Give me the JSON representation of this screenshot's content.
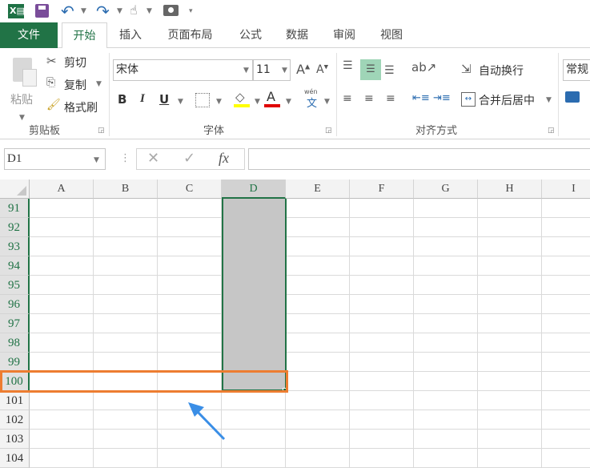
{
  "qat": {
    "icons": [
      "excel-icon",
      "save-icon",
      "undo-icon",
      "redo-icon",
      "touch-mode-icon",
      "camera-icon",
      "customize-icon"
    ]
  },
  "tabs": [
    "文件",
    "开始",
    "插入",
    "页面布局",
    "公式",
    "数据",
    "审阅",
    "视图"
  ],
  "clipboard": {
    "paste": "粘贴",
    "cut": "剪切",
    "copy": "复制",
    "format_painter": "格式刷",
    "label": "剪贴板"
  },
  "font": {
    "name": "宋体",
    "size": "11",
    "bold": "B",
    "italic": "I",
    "underline": "U",
    "font_color": "A",
    "phonetic_top": "wén",
    "phonetic": "文",
    "label": "字体",
    "fill_color": "#ffff00",
    "text_color": "#e00000"
  },
  "alignment": {
    "wrap": "自动换行",
    "merge": "合并后居中",
    "label": "对齐方式"
  },
  "number": {
    "format": "常规"
  },
  "formula_bar": {
    "name_box": "D1",
    "cancel": "✕",
    "enter": "✓",
    "fx": "fx",
    "value": ""
  },
  "columns": [
    "A",
    "B",
    "C",
    "D",
    "E",
    "F",
    "G",
    "H",
    "I"
  ],
  "rows": [
    "91",
    "92",
    "93",
    "94",
    "95",
    "96",
    "97",
    "98",
    "99",
    "100",
    "101",
    "102",
    "103",
    "104"
  ],
  "selection": {
    "range": "D91:D100",
    "highlight_row": "100",
    "highlight_color": "#ed7d31",
    "arrow_color": "#3a8ee6"
  },
  "accent": "#217346"
}
